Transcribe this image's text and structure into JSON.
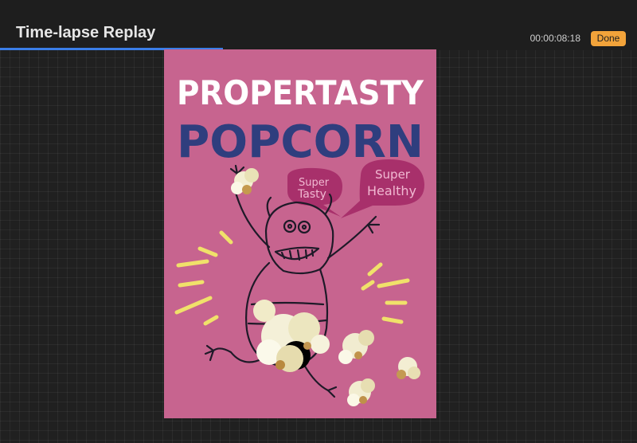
{
  "header": {
    "title": "Time-lapse Replay",
    "elapsed_time": "00:00:08:18",
    "done_label": "Done",
    "accent_color": "#f2a33a",
    "progress": 0.35,
    "progress_color": "#3b7ee8"
  },
  "artwork": {
    "background_color": "#c7648f",
    "headline_top": "PROPERTASTY",
    "headline_bottom": "POPCORN",
    "bubble_left_line1": "Super",
    "bubble_left_line2": "Tasty",
    "bubble_right_line1": "Super",
    "bubble_right_line2": "Healthy"
  }
}
